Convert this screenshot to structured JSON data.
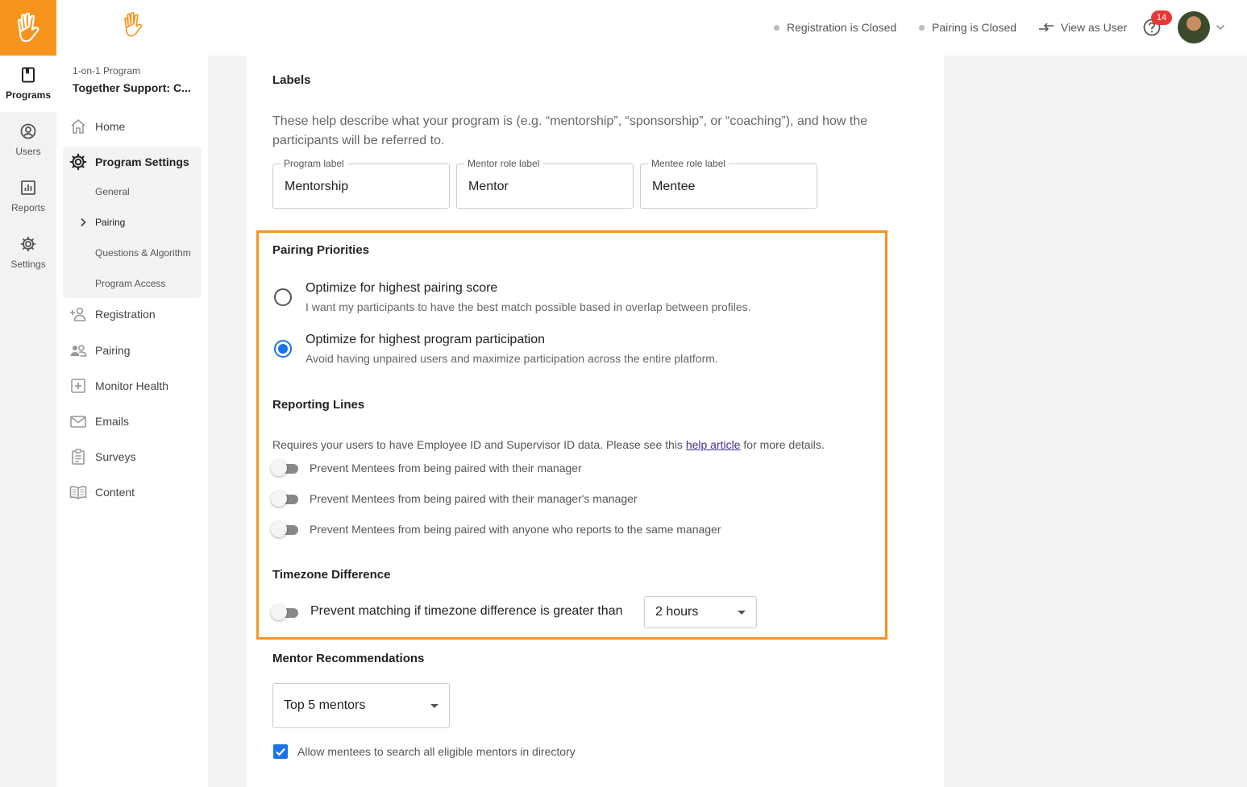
{
  "rail": {
    "items": [
      {
        "label": "Programs",
        "icon": "bookmark-book-icon",
        "active": true
      },
      {
        "label": "Users",
        "icon": "user-circle-icon"
      },
      {
        "label": "Reports",
        "icon": "bar-chart-icon"
      },
      {
        "label": "Settings",
        "icon": "gear-icon"
      }
    ]
  },
  "sidebar": {
    "program_type": "1-on-1 Program",
    "program_name": "Together Support: C...",
    "home": "Home",
    "program_settings": "Program Settings",
    "sub_items": [
      "General",
      "Pairing",
      "Questions & Algorithm",
      "Program Access"
    ],
    "items": [
      "Registration",
      "Pairing",
      "Monitor Health",
      "Emails",
      "Surveys",
      "Content"
    ]
  },
  "topbar": {
    "registration_status": "Registration is Closed",
    "pairing_status": "Pairing is Closed",
    "view_as_user": "View as User",
    "help_badge": "14"
  },
  "labels": {
    "title": "Labels",
    "description": "These help describe what your program is (e.g. “mentorship”, “sponsorship”, or “coaching”), and how the participants will be referred to.",
    "fields": [
      {
        "label": "Program label",
        "value": "Mentorship"
      },
      {
        "label": "Mentor role label",
        "value": "Mentor"
      },
      {
        "label": "Mentee role label",
        "value": "Mentee"
      }
    ]
  },
  "pairing_priorities": {
    "title": "Pairing Priorities",
    "options": [
      {
        "title": "Optimize for highest pairing score",
        "subtitle": "I want my participants to have the best match possible based in overlap between profiles.",
        "selected": false
      },
      {
        "title": "Optimize for highest program participation",
        "subtitle": "Avoid having unpaired users and maximize participation across the entire platform.",
        "selected": true
      }
    ]
  },
  "reporting_lines": {
    "title": "Reporting Lines",
    "requirement_prefix": "Requires your users to have Employee ID and Supervisor ID data. Please see this",
    "help_link": "help article",
    "requirement_suffix": "for more details.",
    "toggles": [
      "Prevent Mentees from being paired with their manager",
      "Prevent Mentees from being paired with their manager's manager",
      "Prevent Mentees from being paired with anyone who reports to the same manager"
    ]
  },
  "timezone": {
    "title": "Timezone Difference",
    "toggle_label": "Prevent matching if timezone difference is greater than",
    "selected": "2 hours"
  },
  "mentor_recommendations": {
    "title": "Mentor Recommendations",
    "selected": "Top 5 mentors",
    "checkbox_label": "Allow mentees to search all eligible mentors in directory",
    "checked": true
  },
  "colors": {
    "brand": "#f7941d",
    "accent": "#1a73e8",
    "badge": "#e53935"
  }
}
